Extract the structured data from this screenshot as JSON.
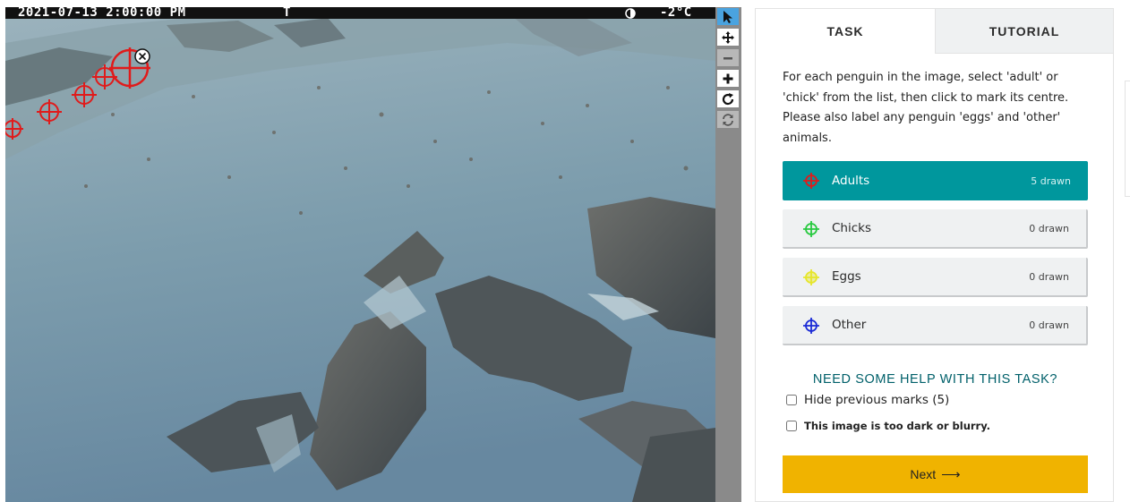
{
  "camera": {
    "datetime": "2021-07-13 2:00:00 PM",
    "marker": "T",
    "moon_icon": "moon-phase-icon",
    "temperature": "-2°C"
  },
  "marks": {
    "count": 5,
    "color": "#e01b1b",
    "remove_icon": "close-circle-icon"
  },
  "toolbar": {
    "tools": [
      {
        "name": "pointer-tool",
        "icon": "cursor-arrow-icon",
        "state": "active"
      },
      {
        "name": "move-tool",
        "icon": "move-arrows-icon",
        "state": "normal"
      },
      {
        "name": "zoom-out-tool",
        "icon": "minus-icon",
        "state": "disabled"
      },
      {
        "name": "zoom-in-tool",
        "icon": "plus-icon",
        "state": "normal"
      },
      {
        "name": "rotate-tool",
        "icon": "rotate-icon",
        "state": "normal"
      },
      {
        "name": "reset-tool",
        "icon": "reset-icon",
        "state": "disabled"
      }
    ]
  },
  "tabs": {
    "task": "TASK",
    "tutorial": "TUTORIAL"
  },
  "task": {
    "instructions": "For each penguin in the image, select 'adult' or 'chick' from the list, then click to mark its centre. Please also label any penguin 'eggs' and 'other' animals.",
    "tools": [
      {
        "label": "Adults",
        "count": "5 drawn",
        "color": "#e01b1b",
        "selected": true
      },
      {
        "label": "Chicks",
        "count": "0 drawn",
        "color": "#27c93f",
        "selected": false
      },
      {
        "label": "Eggs",
        "count": "0 drawn",
        "color": "#e6e62a",
        "selected": false
      },
      {
        "label": "Other",
        "count": "0 drawn",
        "color": "#1b2bd6",
        "selected": false
      }
    ],
    "help": "NEED SOME HELP WITH THIS TASK?",
    "hide_marks": "Hide previous marks (5)",
    "too_dark": "This image is too dark or blurry.",
    "next": "Next"
  },
  "colors": {
    "accent": "#00979d",
    "next_button": "#f0b300",
    "help_text": "#00606a"
  }
}
